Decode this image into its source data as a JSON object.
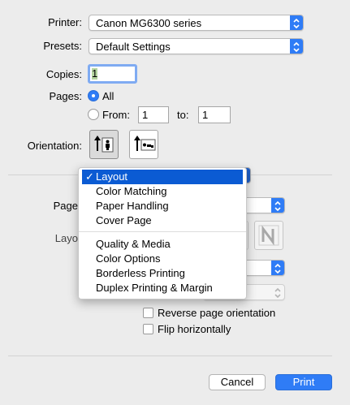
{
  "printer": {
    "label": "Printer:",
    "value": "Canon MG6300 series"
  },
  "presets": {
    "label": "Presets:",
    "value": "Default Settings"
  },
  "copies": {
    "label": "Copies:",
    "value": "1"
  },
  "pages": {
    "label": "Pages:",
    "all_label": "All",
    "from_label": "From:",
    "from_value": "1",
    "to_label": "to:",
    "to_value": "1",
    "selected": "All"
  },
  "orientation": {
    "label": "Orientation:",
    "selected": "portrait"
  },
  "behind_menu": {
    "page_label": "Page",
    "layout_label": "Layo"
  },
  "section_menu": {
    "items": [
      {
        "label": "Layout",
        "checked": true
      },
      {
        "label": "Color Matching"
      },
      {
        "label": "Paper Handling"
      },
      {
        "label": "Cover Page"
      },
      {
        "label": "Quality & Media"
      },
      {
        "label": "Color Options"
      },
      {
        "label": "Borderless Printing"
      },
      {
        "label": "Duplex Printing & Margin"
      }
    ],
    "check_glyph": "✓"
  },
  "options": {
    "reverse_orientation": {
      "label": "Reverse page orientation",
      "checked": false
    },
    "flip_horizontally": {
      "label": "Flip horizontally",
      "checked": false
    }
  },
  "buttons": {
    "cancel": "Cancel",
    "print": "Print"
  },
  "colors": {
    "accent": "#2f7cf6",
    "menu_highlight": "#0b5bd3",
    "background": "#ececec"
  }
}
